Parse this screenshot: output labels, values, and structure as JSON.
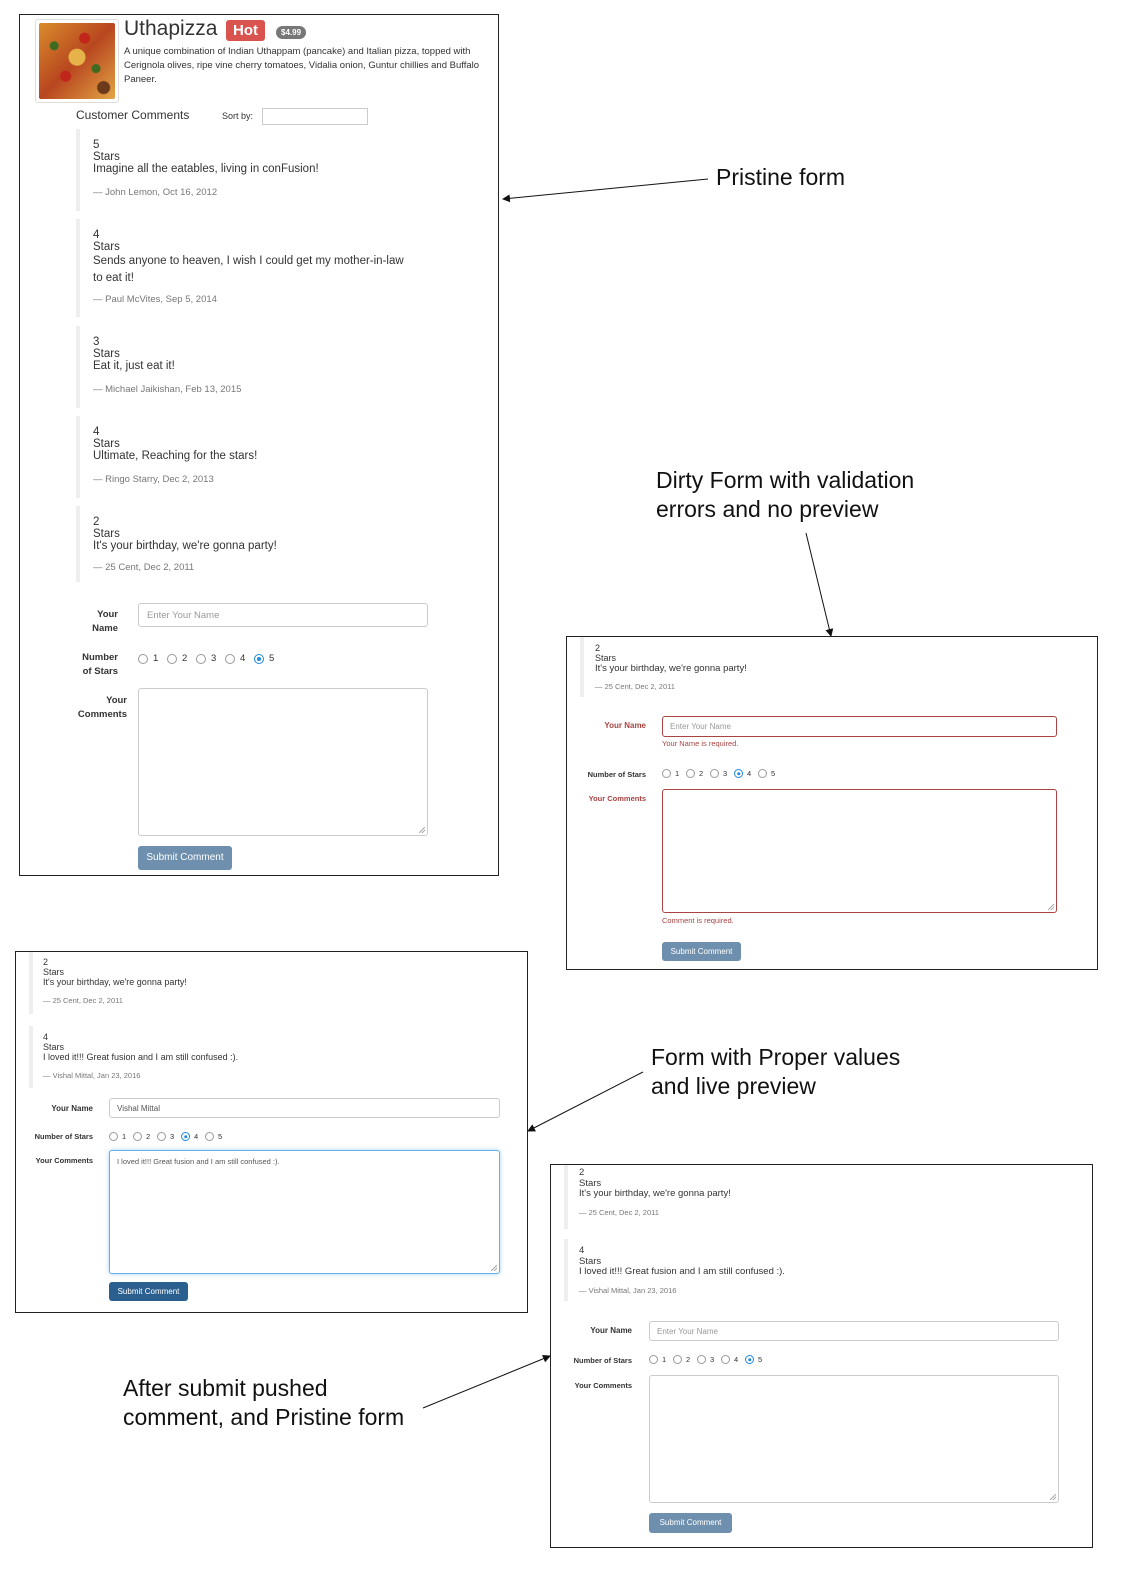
{
  "annotations": {
    "pristine": "Pristine form",
    "dirty_line1": "Dirty Form with validation",
    "dirty_line2": "errors and no preview",
    "proper_line1": "Form with Proper values",
    "proper_line2": "and live preview",
    "after_line1": "After submit pushed",
    "after_line2": "comment, and Pristine form"
  },
  "dish": {
    "name": "Uthapizza",
    "label": "Hot",
    "price": "$4.99",
    "description": "A unique combination of Indian Uthappam (pancake) and Italian pizza, topped with Cerignola olives, ripe vine cherry tomatoes, Vidalia onion, Guntur chillies and Buffalo Paneer."
  },
  "comments_section": {
    "title": "Customer Comments",
    "sort_label": "Sort by:",
    "sort_value": ""
  },
  "comments": [
    {
      "stars": "5 Stars",
      "text": "Imagine all the eatables, living in conFusion!",
      "footer": "— John Lemon, Oct 16, 2012"
    },
    {
      "stars": "4 Stars",
      "text": "Sends anyone to heaven, I wish I could get my mother-in-law to eat it!",
      "footer": "— Paul McVites, Sep 5, 2014"
    },
    {
      "stars": "3 Stars",
      "text": "Eat it, just eat it!",
      "footer": "— Michael Jaikishan, Feb 13, 2015"
    },
    {
      "stars": "4 Stars",
      "text": "Ultimate, Reaching for the stars!",
      "footer": "— Ringo Starry, Dec 2, 2013"
    },
    {
      "stars": "2 Stars",
      "text": "It's your birthday, we're gonna party!",
      "footer": "— 25 Cent, Dec 2, 2011"
    }
  ],
  "new_comment": {
    "stars": "4 Stars",
    "text": "I loved it!!! Great fusion and I am still confused :).",
    "footer": "— Vishal Mittal, Jan 23, 2016"
  },
  "form": {
    "name_label": "Your Name",
    "name_label_l1": "Your",
    "name_label_l2": "Name",
    "name_placeholder": "Enter Your Name",
    "stars_label": "Number of Stars",
    "stars_label_l1": "Number",
    "stars_label_l2": "of Stars",
    "comments_label": "Your Comments",
    "comments_label_l1": "Your",
    "comments_label_l2": "Comments",
    "radio_options": [
      "1",
      "2",
      "3",
      "4",
      "5"
    ],
    "submit_label": "Submit Comment",
    "name_error": "Your Name is required.",
    "comment_error": "Comment is required.",
    "filled_name": "Vishal Mittal",
    "filled_comment": "I loved it!!! Great fusion and I am still confused :).",
    "selected_pristine": "5",
    "selected_dirty": "4",
    "selected_proper": "4",
    "selected_after": "5"
  }
}
